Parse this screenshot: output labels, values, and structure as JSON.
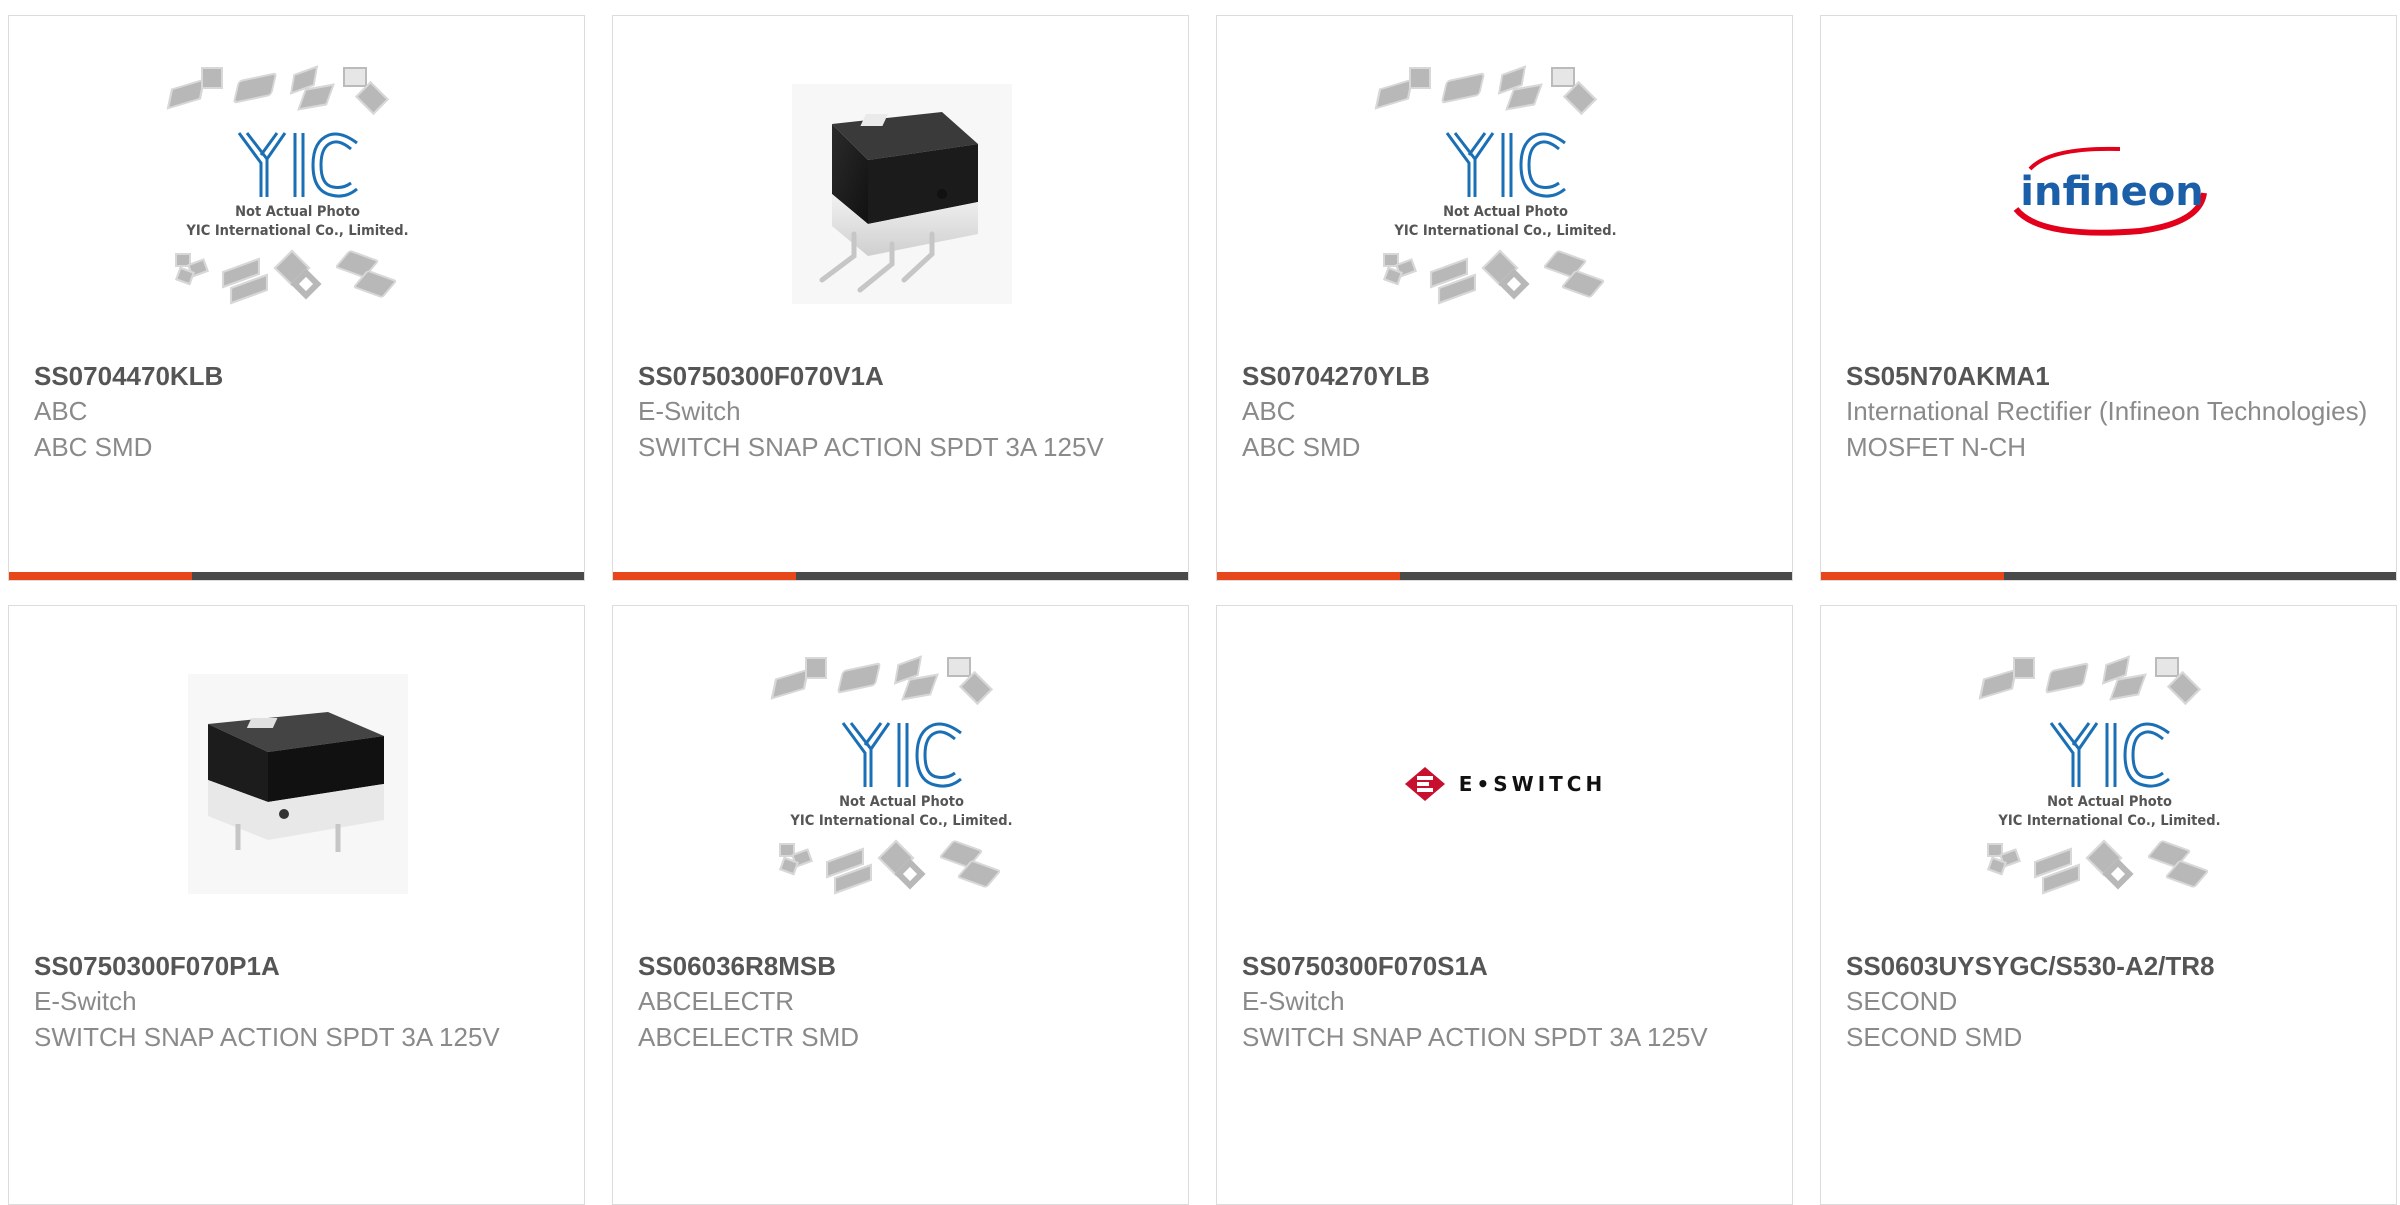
{
  "placeholder": {
    "caption_line1": "Not Actual Photo",
    "caption_line2": "YIC International Co., Limited.",
    "logo_text": "YIC"
  },
  "brand_logos": {
    "infineon": "infineon",
    "eswitch": "E•SWITCH"
  },
  "products": [
    {
      "part_number": "SS0704470KLB",
      "manufacturer": "ABC",
      "description": "ABC SMD",
      "image": "yic-placeholder"
    },
    {
      "part_number": "SS0750300F070V1A",
      "manufacturer": "E-Switch",
      "description": "SWITCH SNAP ACTION SPDT 3A 125V",
      "image": "snap-switch-photo"
    },
    {
      "part_number": "SS0704270YLB",
      "manufacturer": "ABC",
      "description": "ABC SMD",
      "image": "yic-placeholder"
    },
    {
      "part_number": "SS05N70AKMA1",
      "manufacturer": "International Rectifier (Infineon Technologies)",
      "description": "MOSFET N-CH",
      "image": "infineon-logo"
    },
    {
      "part_number": "SS0750300F070P1A",
      "manufacturer": "E-Switch",
      "description": "SWITCH SNAP ACTION SPDT 3A 125V",
      "image": "snap-switch-photo"
    },
    {
      "part_number": "SS06036R8MSB",
      "manufacturer": "ABCELECTR",
      "description": "ABCELECTR SMD",
      "image": "yic-placeholder"
    },
    {
      "part_number": "SS0750300F070S1A",
      "manufacturer": "E-Switch",
      "description": "SWITCH SNAP ACTION SPDT 3A 125V",
      "image": "eswitch-logo"
    },
    {
      "part_number": "SS0603UYSYGC/S530-A2/TR8",
      "manufacturer": "SECOND",
      "description": "SECOND SMD",
      "image": "yic-placeholder"
    }
  ],
  "colors": {
    "accent": "#e8471c",
    "bar_dark": "#4a4a4a",
    "part_number": "#555555",
    "secondary_text": "#8a8a8a",
    "yic_blue": "#1a6fb5",
    "infineon_blue": "#1b5fa8",
    "infineon_red": "#e2001a",
    "eswitch_red": "#c8102e"
  }
}
